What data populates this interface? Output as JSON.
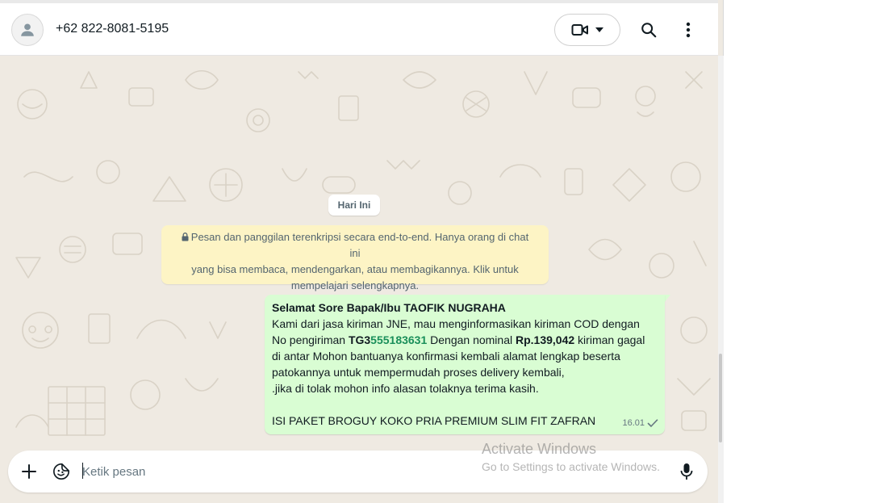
{
  "header": {
    "contact_name": "+62 822-8081-5195",
    "icons": [
      "person-icon",
      "video-icon",
      "chevron-down-icon",
      "search-icon",
      "more-vertical-icon"
    ]
  },
  "chat": {
    "date_label": "Hari Ini",
    "encryption_notice": {
      "lines": [
        "Pesan dan panggilan terenkripsi secara end-to-end. Hanya orang di chat ini",
        "yang bisa membaca, mendengarkan, atau membagikannya. Klik untuk",
        "mempelajari selengkapnya."
      ]
    },
    "message": {
      "greeting": "Selamat Sore Bapak/Ibu TAOFIK NUGRAHA",
      "line2": "Kami dari jasa kiriman JNE, mau menginformasikan kiriman COD dengan",
      "line3_pre": "No pengiriman ",
      "tracking_prefix": "TG3",
      "tracking_number": "555183631",
      "line3_mid": " Dengan nominal ",
      "amount": "Rp.139,042",
      "line3_post": " kiriman gagal",
      "line4": "di antar Mohon bantuanya konfirmasi kembali alamat lengkap beserta",
      "line5": "patokannya untuk mempermudah proses delivery kembali,",
      "line6": " .jika di tolak mohon info alasan tolaknya terima kasih.",
      "line8": "ISI PAKET BROGUY KOKO PRIA PREMIUM SLIM FIT ZAFRAN",
      "time": "16.01",
      "status": "sent"
    }
  },
  "composer": {
    "placeholder": "Ketik pesan"
  },
  "watermark": {
    "title": "Activate Windows",
    "subtitle": "Go to Settings to activate Windows."
  },
  "colors": {
    "chat_bg": "#efeae2",
    "outgoing_bubble": "#d9fdd3",
    "notice_bg": "#fdf4c5",
    "tracking_green": "#1a8f5a"
  }
}
